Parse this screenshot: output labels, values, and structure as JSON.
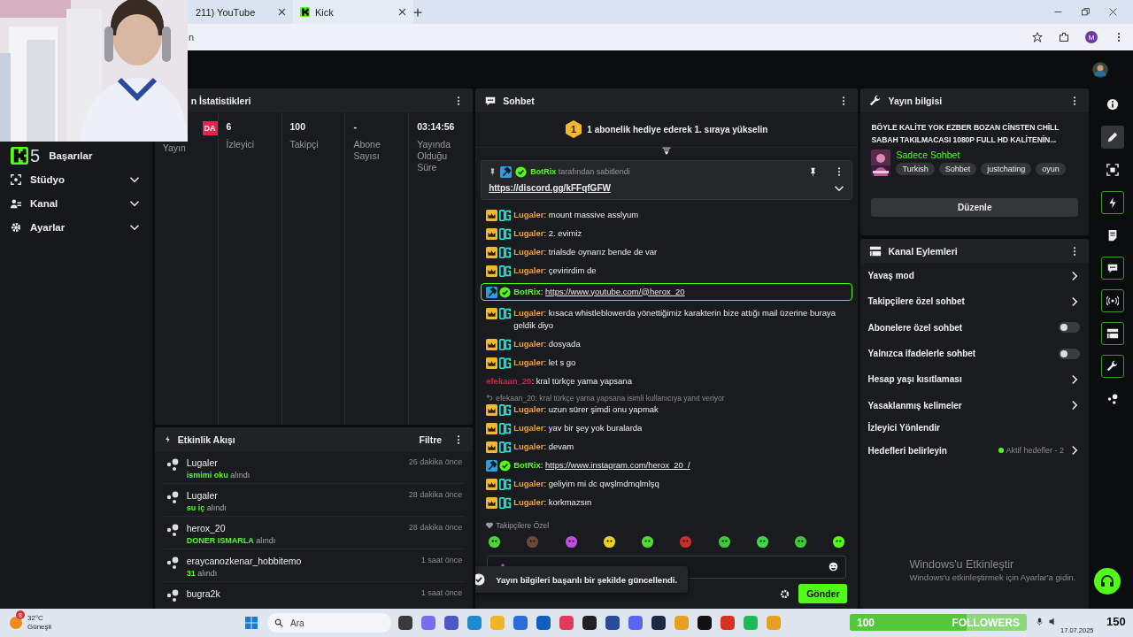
{
  "browser": {
    "tabs": [
      {
        "title": "211) YouTube",
        "selected": false
      },
      {
        "title": "Kick",
        "selected": true
      }
    ],
    "address": "n",
    "profile": "M"
  },
  "overlay": {
    "count": "5"
  },
  "sidebar": {
    "items": [
      {
        "label": "Başarılar",
        "kind": "none",
        "expandable": false
      },
      {
        "label": "Stüdyo",
        "kind": "studio",
        "expandable": true
      },
      {
        "label": "Kanal",
        "kind": "channel",
        "expandable": true
      },
      {
        "label": "Ayarlar",
        "kind": "gear",
        "expandable": true
      }
    ]
  },
  "stats": {
    "title": "n İstatistikleri",
    "columns": [
      {
        "kind": "badge",
        "value": "DA",
        "label": "Yayın"
      },
      {
        "kind": "number",
        "value": "6",
        "label": "İzleyici"
      },
      {
        "kind": "number",
        "value": "100",
        "label": "Takipçi"
      },
      {
        "kind": "number",
        "value": "-",
        "label": "Abone Sayısı"
      },
      {
        "kind": "number",
        "value": "03:14:56",
        "label": "Yayında Olduğu Süre"
      }
    ]
  },
  "activity": {
    "title": "Etkinlik Akışı",
    "filter": "Filtre",
    "items": [
      {
        "name": "Lugaler",
        "reward": "ismimi oku",
        "suffix": "alındı",
        "time": "26 dakika önce"
      },
      {
        "name": "Lugaler",
        "reward": "su iç",
        "suffix": "alındı",
        "time": "28 dakika önce"
      },
      {
        "name": "herox_20",
        "reward": "DONER ISMARLA",
        "suffix": "alındı",
        "time": "28 dakika önce"
      },
      {
        "name": "eraycanozkenar_hobbitemo",
        "reward": "31",
        "suffix": "alındı",
        "time": "1 saat önce"
      },
      {
        "name": "bugra2k",
        "time": "1 saat önce"
      }
    ]
  },
  "chat": {
    "title": "Sohbet",
    "promo": {
      "rank": "1",
      "text": "1 abonelik hediye ederek 1. sıraya yükselin"
    },
    "pinned": {
      "author": "BotRix",
      "by": "tarafından sabitlendi",
      "link": "https://discord.gg/kFFqfGFW"
    },
    "messages": [
      {
        "kind": "sub",
        "name": "Lugaler",
        "color": "#f0a33a",
        "text": ": mount massive asslyum"
      },
      {
        "kind": "sub",
        "name": "Lugaler",
        "color": "#f0a33a",
        "text": ": 2. evimiz"
      },
      {
        "kind": "sub",
        "name": "Lugaler",
        "color": "#f0a33a",
        "text": ": trialsde oynarız bende de var"
      },
      {
        "kind": "sub",
        "name": "Lugaler",
        "color": "#f0a33a",
        "text": ": çevirirdim de"
      },
      {
        "kind": "bot",
        "name": "BotRix",
        "color": "#53fc18",
        "text": ": ",
        "link": "https://www.youtube.com/@herox_20",
        "highlighted": true
      },
      {
        "kind": "sub",
        "name": "Lugaler",
        "color": "#f0a33a",
        "text": ": kısaca whistleblowerda yönettiğimiz karakterin bize attığı mail üzerine buraya geldik diyo"
      },
      {
        "kind": "sub",
        "name": "Lugaler",
        "color": "#f0a33a",
        "text": ": dosyada"
      },
      {
        "kind": "sub",
        "name": "Lugaler",
        "color": "#f0a33a",
        "text": ": let s go"
      },
      {
        "kind": "plain",
        "name": "efekaan_20",
        "color": "#d4224a",
        "text": ": kral türkçe yama yapsana"
      },
      {
        "kind": "reply",
        "text": "efekaan_20: kral türkçe yama yapsana isimli kullanıcıya yanıt veriyor"
      },
      {
        "kind": "sub",
        "name": "Lugaler",
        "color": "#f0a33a",
        "text": ": uzun sürer şimdi onu yapmak"
      },
      {
        "kind": "sub",
        "name": "Lugaler",
        "color": "#f0a33a",
        "text": ": yav bir şey yok buralarda"
      },
      {
        "kind": "sub",
        "name": "Lugaler",
        "color": "#f0a33a",
        "text": ": devam"
      },
      {
        "kind": "bot",
        "name": "BotRix",
        "color": "#53fc18",
        "text": ": ",
        "link": "https://www.instagram.com/herox_20_/",
        "highlighted": false
      },
      {
        "kind": "sub",
        "name": "Lugaler",
        "color": "#f0a33a",
        "text": ": geliyim mi dc qwşlmdmqlmlşq"
      },
      {
        "kind": "sub",
        "name": "Lugaler",
        "color": "#f0a33a",
        "text": ": korkmazsın"
      }
    ],
    "emote_label": "Takipçilere Özel",
    "send": "Gönder",
    "toast": "Yayın bilgileri başarılı bir şekilde güncellendi."
  },
  "stream_info": {
    "title": "Yayın bilgisi",
    "stream_title": "BÖYLE KALİTE YOK EZBER BOZAN CİNSTEN CHİLL SABAH TAKILMACASI 1080P FULL HD KALİTENİN...",
    "category": "Sadece Sohbet",
    "tags": [
      "Turkish",
      "Sohbet",
      "justchating",
      "oyun"
    ],
    "edit": "Düzenle"
  },
  "channel_actions": {
    "title": "Kanal Eylemleri",
    "items": [
      {
        "kind": "link",
        "label": "Yavaş mod"
      },
      {
        "kind": "link",
        "label": "Takipçilere özel sohbet"
      },
      {
        "kind": "toggle",
        "label": "Abonelere özel sohbet",
        "on": false
      },
      {
        "kind": "toggle",
        "label": "Yalnızca ifadelerle sohbet",
        "on": false
      },
      {
        "kind": "link",
        "label": "Hesap yaşı kısıtlaması"
      },
      {
        "kind": "link",
        "label": "Yasaklanmış kelimeler"
      },
      {
        "kind": "plain",
        "label": "İzleyici Yönlendir"
      },
      {
        "kind": "goals",
        "label": "Hedefleri belirleyin",
        "status": "Aktif hedefler - 2"
      }
    ]
  },
  "activation_notice": {
    "title": "Windows'u Etkinleştir",
    "text": "Windows'u etkinleştirmek için Ayarlar'a gidin."
  },
  "rail": [
    {
      "kind": "info",
      "outlined": false,
      "selected": false
    },
    {
      "kind": "pencil",
      "outlined": false,
      "selected": true
    },
    {
      "kind": "focus",
      "outlined": false,
      "selected": false
    },
    {
      "kind": "bolt",
      "outlined": true,
      "selected": false
    },
    {
      "kind": "note",
      "outlined": false,
      "selected": false
    },
    {
      "kind": "chat",
      "outlined": true,
      "selected": false
    },
    {
      "kind": "broadcast",
      "outlined": true,
      "selected": false
    },
    {
      "kind": "layout",
      "outlined": true,
      "selected": false
    },
    {
      "kind": "wrench",
      "outlined": true,
      "selected": false
    },
    {
      "kind": "dots",
      "outlined": false,
      "selected": false
    }
  ],
  "taskbar": {
    "weather": {
      "badge": "8",
      "temp": "32°C",
      "condition": "Güneşli"
    },
    "search": "Ara",
    "followers": {
      "current": "100",
      "label": "FOLLOWERS",
      "goal": "150",
      "level": 0.66
    },
    "date": "17.07.2025"
  }
}
